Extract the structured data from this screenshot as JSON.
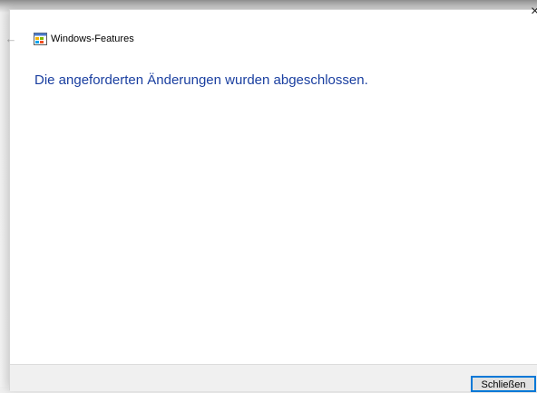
{
  "window": {
    "title": "Windows-Features",
    "close_glyph": "×",
    "back_glyph": "←"
  },
  "main": {
    "headline": "Die angeforderten Änderungen wurden abgeschlossen."
  },
  "footer": {
    "close_button_label": "Schließen"
  },
  "icons": {
    "back": "back-arrow-icon",
    "app": "windows-features-icon",
    "close": "close-icon"
  },
  "colors": {
    "headline": "#1a3fa0",
    "focus_border": "#0078d7"
  }
}
